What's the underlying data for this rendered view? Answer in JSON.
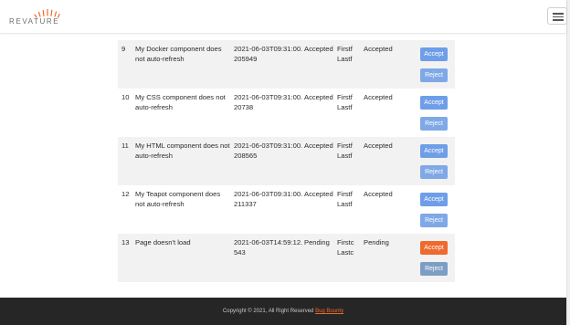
{
  "brand": {
    "name": "REVATURE",
    "accent": "#f26925"
  },
  "nav": {
    "menu_icon": "hamburger-menu-icon"
  },
  "colors": {
    "accept_blue": "#6f9ee8",
    "reject_blue": "#7fa8e6",
    "accept_orange": "#ee6a2e",
    "reject_muted": "#7c9ec4",
    "row_stripe": "#f2f2f2",
    "footer_bg": "#262626"
  },
  "tickets": [
    {
      "id": "9",
      "title": "My Docker component does not auto-refresh",
      "date": "2021-06-03T09:31:00.205949",
      "status": "Accepted",
      "user": "Firstf Lastf",
      "resolution": "Accepted",
      "accept_label": "Accept",
      "reject_label": "Reject",
      "accept_color": "#6f9ee8",
      "reject_color": "#7fa8e6"
    },
    {
      "id": "10",
      "title": "My CSS component does not auto-refresh",
      "date": "2021-06-03T09:31:00.20738",
      "status": "Accepted",
      "user": "Firstf Lastf",
      "resolution": "Accepted",
      "accept_label": "Accept",
      "reject_label": "Reject",
      "accept_color": "#6f9ee8",
      "reject_color": "#7fa8e6"
    },
    {
      "id": "11",
      "title": "My HTML component does not auto-refresh",
      "date": "2021-06-03T09:31:00.208565",
      "status": "Accepted",
      "user": "Firstf Lastf",
      "resolution": "Accepted",
      "accept_label": "Accept",
      "reject_label": "Reject",
      "accept_color": "#6f9ee8",
      "reject_color": "#7fa8e6"
    },
    {
      "id": "12",
      "title": "My Teapot component does not auto-refresh",
      "date": "2021-06-03T09:31:00.211337",
      "status": "Accepted",
      "user": "Firstf Lastf",
      "resolution": "Accepted",
      "accept_label": "Accept",
      "reject_label": "Reject",
      "accept_color": "#6f9ee8",
      "reject_color": "#7fa8e6"
    },
    {
      "id": "13",
      "title": "Page doesn't load",
      "date": "2021-06-03T14:59:12.543",
      "status": "Pending",
      "user": "Firstc Lastc",
      "resolution": "Pending",
      "accept_label": "Accept",
      "reject_label": "Reject",
      "accept_color": "#ee6a2e",
      "reject_color": "#7c9ec4"
    }
  ],
  "footer": {
    "copyright": "Copyright © 2021, All Right Reserved",
    "link_text": "Bug Bounty"
  }
}
